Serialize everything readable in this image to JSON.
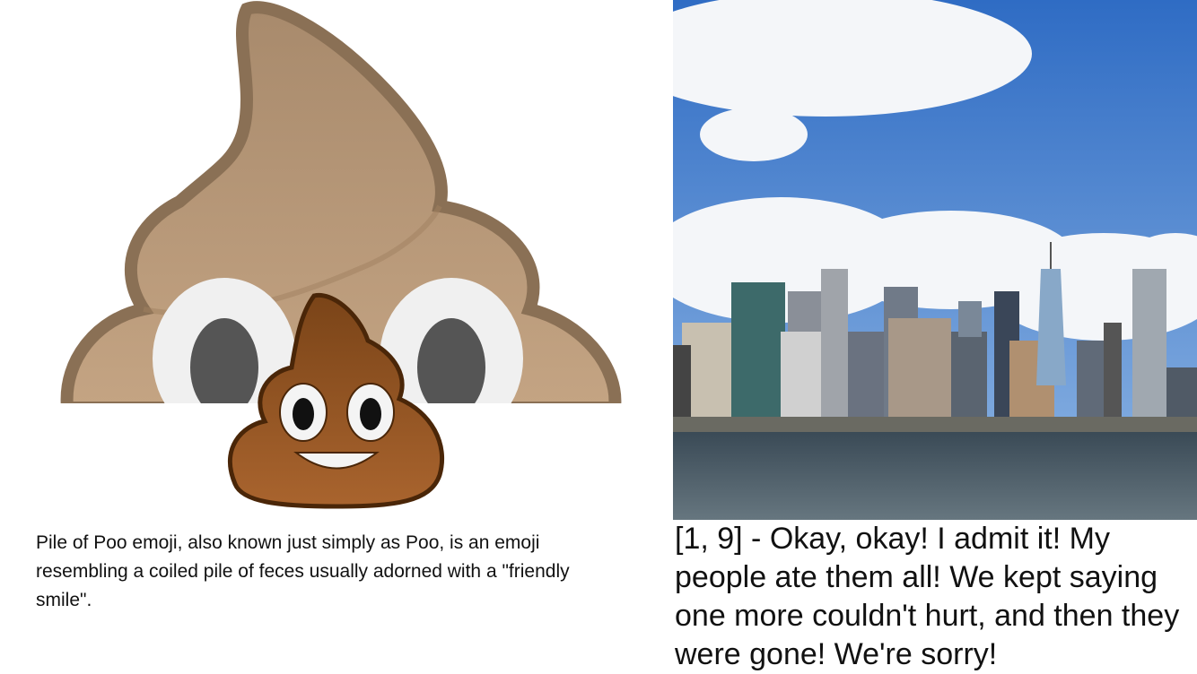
{
  "left_panel": {
    "image_icon": "pile-of-poo-emoji",
    "description": "Pile of Poo emoji, also known just simply as Poo, is an emoji resembling a coiled pile of feces usually adorned with a \"friendly smile\"."
  },
  "right_panel": {
    "image": "city-skyline-photo",
    "caption": "[1, 9] - Okay, okay! I admit it! My people ate them all! We kept saying one more couldn't hurt, and then they were gone! We're sorry!"
  },
  "colors": {
    "poo_light": "#b89878",
    "poo_outline": "#8a7055",
    "poo_dark": "#8b4a1c",
    "sky": "#3f7fd0",
    "water": "#4a5a66"
  }
}
